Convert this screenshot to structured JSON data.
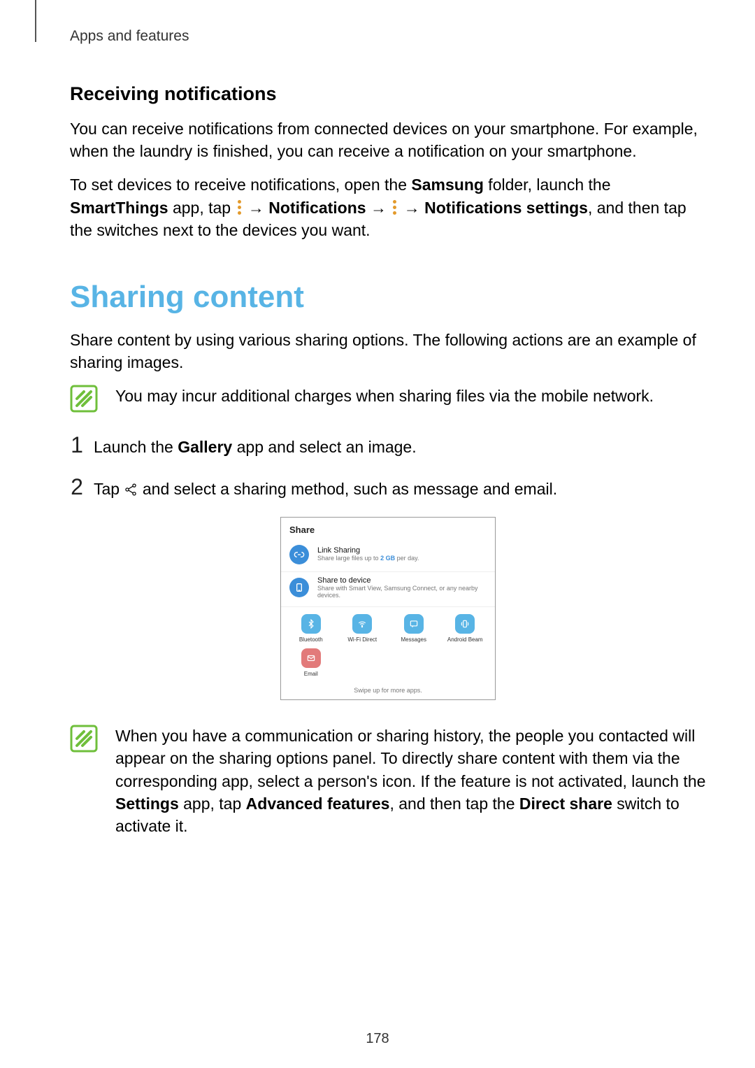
{
  "breadcrumb": "Apps and features",
  "section1": {
    "title": "Receiving notifications",
    "p1": "You can receive notifications from connected devices on your smartphone. For example, when the laundry is finished, you can receive a notification on your smartphone.",
    "p2a": "To set devices to receive notifications, open the ",
    "p2b_bold": "Samsung",
    "p2c": " folder, launch the ",
    "p2d_bold": "SmartThings",
    "p2e": " app, tap ",
    "p2f": " → ",
    "p2g_bold": "Notifications",
    "p2h": " → ",
    "p2i": " → ",
    "p2j_bold": "Notifications settings",
    "p2k": ", and then tap the switches next to the devices you want."
  },
  "section2": {
    "title": "Sharing content",
    "p1": "Share content by using various sharing options. The following actions are an example of sharing images.",
    "note1": "You may incur additional charges when sharing files via the mobile network.",
    "step1_num": "1",
    "step1a": "Launch the ",
    "step1b_bold": "Gallery",
    "step1c": " app and select an image.",
    "step2_num": "2",
    "step2a": "Tap ",
    "step2b": " and select a sharing method, such as message and email.",
    "note2a": "When you have a communication or sharing history, the people you contacted will appear on the sharing options panel. To directly share content with them via the corresponding app, select a person's icon. If the feature is not activated, launch the ",
    "note2b_bold": "Settings",
    "note2c": " app, tap ",
    "note2d_bold": "Advanced features",
    "note2e": ", and then tap the ",
    "note2f_bold": "Direct share",
    "note2g": " switch to activate it."
  },
  "share_panel": {
    "header": "Share",
    "link_sharing": {
      "title": "Link Sharing",
      "sub_a": "Share large files up to ",
      "sub_b": "2 GB",
      "sub_c": " per day."
    },
    "share_to_device": {
      "title": "Share to device",
      "sub": "Share with Smart View, Samsung Connect, or any nearby devices."
    },
    "apps": [
      "Bluetooth",
      "Wi-Fi Direct",
      "Messages",
      "Android Beam",
      "Email"
    ],
    "swipe": "Swipe up for more apps."
  },
  "colors": {
    "link_sharing_bg": "#3b8ed9",
    "share_device_bg": "#3b8ed9",
    "bluetooth_bg": "#58b4e5",
    "wifi_bg": "#58b4e5",
    "messages_bg": "#58b4e5",
    "beam_bg": "#58b4e5",
    "email_bg": "#e27a7a"
  },
  "page_number": "178"
}
